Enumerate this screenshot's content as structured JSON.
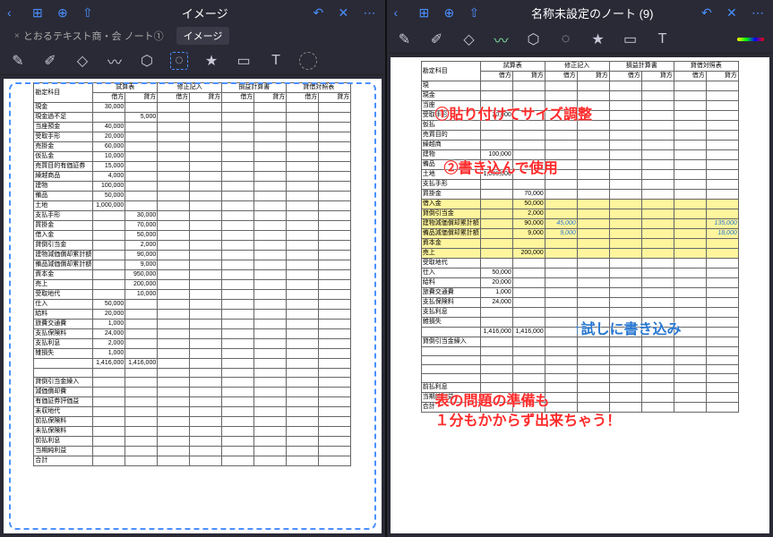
{
  "left": {
    "title": "イメージ",
    "tabs": [
      {
        "label": "とおるテキスト商・会 ノート①",
        "active": false
      },
      {
        "label": "イメージ",
        "active": true
      }
    ]
  },
  "right": {
    "title": "名称未設定のノート (9)"
  },
  "sheet_headers": {
    "account": "勘定科目",
    "groups": [
      "試算表",
      "修正記入",
      "損益計算書",
      "貸借対照表"
    ],
    "sub": [
      "借方",
      "貸方"
    ]
  },
  "rows": [
    {
      "l": "現金",
      "d": "30,000"
    },
    {
      "l": "現金過不足",
      "c": "5,000"
    },
    {
      "l": "当座預金",
      "d": "40,000"
    },
    {
      "l": "受取手形",
      "d": "20,000"
    },
    {
      "l": "売掛金",
      "d": "60,000"
    },
    {
      "l": "仮払金",
      "d": "10,000"
    },
    {
      "l": "売買目的有価証券",
      "d": "15,000"
    },
    {
      "l": "繰越商品",
      "d": "4,000"
    },
    {
      "l": "建物",
      "d": "100,000"
    },
    {
      "l": "備品",
      "d": "50,000"
    },
    {
      "l": "土地",
      "d": "1,000,000"
    },
    {
      "l": "支払手形",
      "c": "30,000"
    },
    {
      "l": "買掛金",
      "c": "70,000"
    },
    {
      "l": "借入金",
      "c": "50,000"
    },
    {
      "l": "貸倒引当金",
      "c": "2,000"
    },
    {
      "l": "建物減価償却累計額",
      "c": "90,000"
    },
    {
      "l": "備品減価償却累計額",
      "c": "9,000"
    },
    {
      "l": "資本金",
      "c": "950,000"
    },
    {
      "l": "売上",
      "c": "200,000"
    },
    {
      "l": "受取地代",
      "c": "10,000"
    },
    {
      "l": "仕入",
      "d": "50,000"
    },
    {
      "l": "給料",
      "d": "20,000"
    },
    {
      "l": "旅費交通費",
      "d": "1,000"
    },
    {
      "l": "支払保険料",
      "d": "24,000"
    },
    {
      "l": "支払利息",
      "d": "2,000"
    },
    {
      "l": "雑損失",
      "d": "1,000"
    },
    {
      "l": "",
      "d": "1,416,000",
      "c": "1,416,000"
    },
    {
      "l": ""
    },
    {
      "l": "貸倒引当金繰入"
    },
    {
      "l": "減価償却費"
    },
    {
      "l": "有価証券評価益"
    },
    {
      "l": "未収地代"
    },
    {
      "l": "前払保険料"
    },
    {
      "l": "未払保険料"
    },
    {
      "l": "前払利息"
    },
    {
      "l": "当期純利益"
    },
    {
      "l": "合計"
    }
  ],
  "rows_right": [
    {
      "l": "現"
    },
    {
      "l": "現金"
    },
    {
      "l": "当座"
    },
    {
      "l": "受取手形",
      "d": "20,000"
    },
    {
      "l": "仮払"
    },
    {
      "l": "売買目的"
    },
    {
      "l": "繰越商"
    },
    {
      "l": "建物",
      "d": "100,000"
    },
    {
      "l": "備品"
    },
    {
      "l": "土地",
      "d": "1,000,000"
    },
    {
      "l": "支払手形"
    },
    {
      "l": "買掛金",
      "c": "70,000"
    },
    {
      "l": "借入金",
      "c": "50,000",
      "hl": true
    },
    {
      "l": "貸倒引当金",
      "c": "2,000",
      "hl": true
    },
    {
      "l": "建物減価償却累計額",
      "c": "90,000",
      "hl": true,
      "hand_d": "45,000",
      "hand_c2": "135,000"
    },
    {
      "l": "備品減価償却累計額",
      "c": "9,000",
      "hl": true,
      "hand_d": "9,000",
      "hand_c2": "18,000"
    },
    {
      "l": "資本金",
      "hl": true
    },
    {
      "l": "売上",
      "c": "200,000",
      "hl": true
    },
    {
      "l": "受取地代"
    },
    {
      "l": "仕入",
      "d": "50,000"
    },
    {
      "l": "給料",
      "d": "20,000"
    },
    {
      "l": "旅費交通費",
      "d": "1,000"
    },
    {
      "l": "支払保険料",
      "d": "24,000"
    },
    {
      "l": "支払利息"
    },
    {
      "l": "雑損失"
    },
    {
      "l": "",
      "d": "1,416,000",
      "c": "1,416,000"
    },
    {
      "l": "貸倒引当金繰入"
    },
    {
      "l": ""
    },
    {
      "l": ""
    },
    {
      "l": ""
    },
    {
      "l": ""
    },
    {
      "l": "前払利息"
    },
    {
      "l": "当期純利益"
    },
    {
      "l": "合計"
    }
  ],
  "annotations": {
    "a1": "①貼り付けてサイズ調整",
    "a2": "②書き込んで使用",
    "a3": "↑試しに書き込み",
    "a4": "表の問題の準備も",
    "a5": "１分もかからず出来ちゃう！"
  },
  "handwriting": {
    "v1": "45,000",
    "v2": "9,000",
    "v3": "135,000",
    "v4": "18,000"
  }
}
